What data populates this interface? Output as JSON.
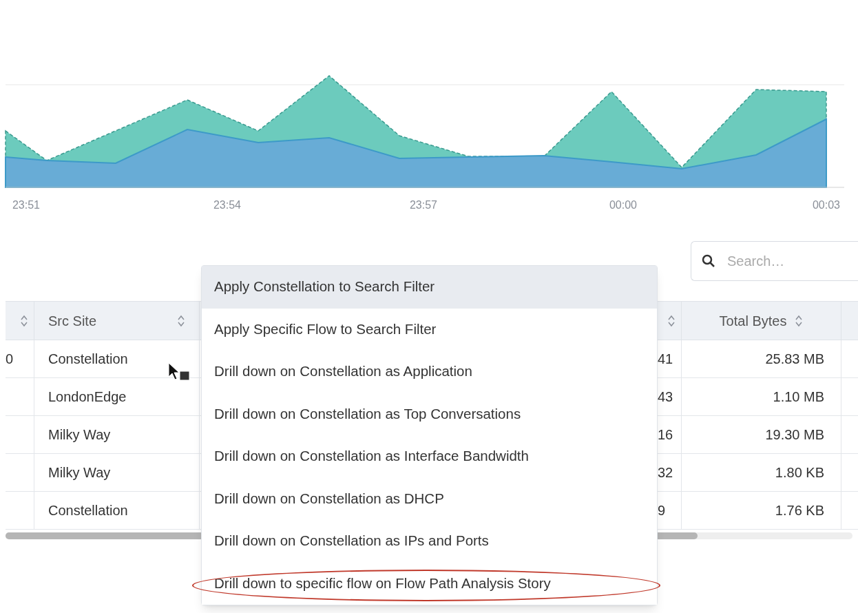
{
  "chart": {
    "x_ticks": [
      "23:51",
      "23:54",
      "23:57",
      "00:00",
      "00:03"
    ]
  },
  "search": {
    "placeholder": "Search…"
  },
  "table": {
    "columns": {
      "src_site": "Src Site",
      "total_bytes": "Total Bytes"
    },
    "rows": [
      {
        "column_1": "0",
        "src_site": "Constellation",
        "column_4": "41",
        "total_bytes": "25.83 MB"
      },
      {
        "src_site": "LondonEdge",
        "column_4": "43",
        "total_bytes": "1.10 MB"
      },
      {
        "src_site": "Milky Way",
        "column_4": "16",
        "total_bytes": "19.30 MB"
      },
      {
        "src_site": "Milky Way",
        "column_4": "32",
        "total_bytes": "1.80 KB"
      },
      {
        "src_site": "Constellation",
        "column_4": "9",
        "total_bytes": "1.76 KB"
      }
    ]
  },
  "context_menu": {
    "items": [
      {
        "label": "Apply Constellation to Search Filter",
        "selected": true,
        "circled": false
      },
      {
        "label": "Apply Specific Flow to Search Filter",
        "selected": false,
        "circled": false
      },
      {
        "label": "Drill down on Constellation as Application",
        "selected": false,
        "circled": false
      },
      {
        "label": "Drill down on Constellation as Top Conversations",
        "selected": false,
        "circled": false
      },
      {
        "label": "Drill down on Constellation as Interface Bandwidth",
        "selected": false,
        "circled": false
      },
      {
        "label": "Drill down on Constellation as DHCP",
        "selected": false,
        "circled": false
      },
      {
        "label": "Drill down on Constellation as IPs and Ports",
        "selected": false,
        "circled": false
      },
      {
        "label": "Drill down to specific flow on Flow Path Analysis Story",
        "selected": false,
        "circled": true
      }
    ]
  }
}
